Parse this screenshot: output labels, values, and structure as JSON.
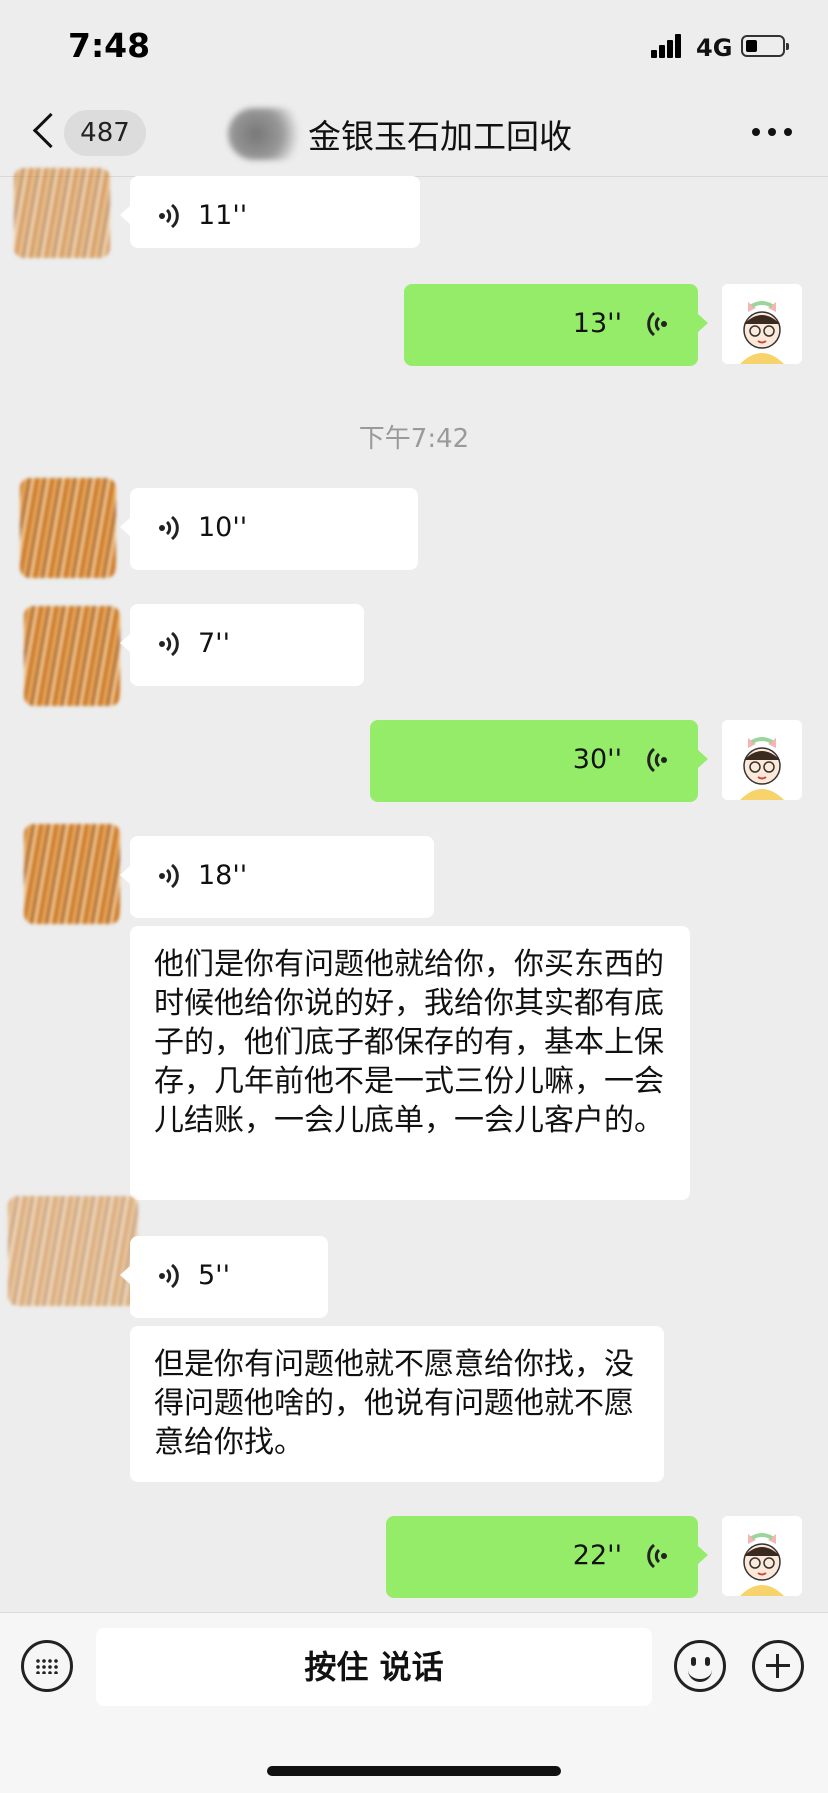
{
  "status": {
    "time": "7:48",
    "network": "4G"
  },
  "nav": {
    "back_count": "487",
    "title": "金银玉石加工回收"
  },
  "messages": {
    "m1": {
      "duration": "11''"
    },
    "m2": {
      "duration": "13''"
    },
    "timestamp": "下午7:42",
    "m3": {
      "duration": "10''"
    },
    "m4": {
      "duration": "7''"
    },
    "m5": {
      "duration": "30''"
    },
    "m6": {
      "duration": "18''"
    },
    "m7": {
      "text": "他们是你有问题他就给你，你买东西的时候他给你说的好，我给你其实都有底子的，他们底子都保存的有，基本上保存，几年前他不是一式三份儿嘛，一会儿结账，一会儿底单，一会儿客户的。"
    },
    "m8": {
      "duration": "5''"
    },
    "m9": {
      "text": "但是你有问题他就不愿意给你找，没得问题他啥的，他说有问题他就不愿意给你找。"
    },
    "m10": {
      "duration": "22''"
    }
  },
  "input": {
    "hold_to_talk": "按住 说话"
  },
  "colors": {
    "sent_bubble": "#95ec69",
    "received_bubble": "#ffffff",
    "background": "#ededed"
  },
  "icons": [
    "back-icon",
    "more-icon",
    "voice-icon",
    "keyboard-icon",
    "emoji-icon",
    "plus-icon"
  ]
}
